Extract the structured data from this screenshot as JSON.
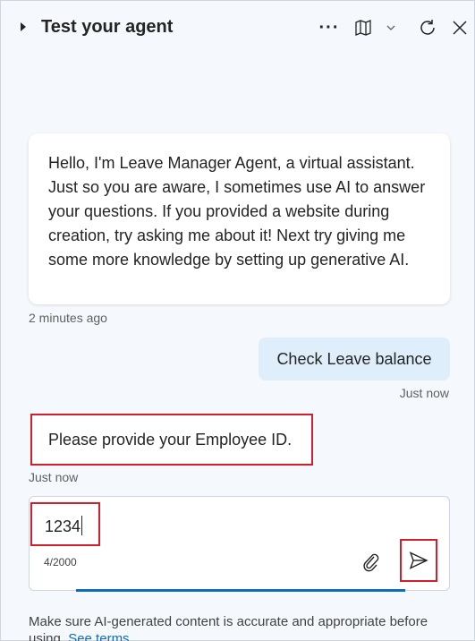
{
  "header": {
    "title": "Test your agent",
    "more_icon": "more-horizontal-icon",
    "map_icon": "map-icon",
    "chevron_icon": "chevron-down-icon",
    "refresh_icon": "refresh-icon",
    "close_icon": "close-icon"
  },
  "messages": [
    {
      "sender": "bot",
      "text": "Hello, I'm Leave Manager Agent, a virtual assistant. Just so you are aware, I sometimes use AI to answer your questions. If you provided a website during creation, try asking me about it! Next try giving me some more knowledge by setting up generative AI.",
      "timestamp": "2 minutes ago"
    },
    {
      "sender": "user",
      "text": "Check Leave balance",
      "timestamp": "Just now"
    },
    {
      "sender": "bot",
      "text": "Please provide your Employee ID.",
      "timestamp": "Just now"
    }
  ],
  "composer": {
    "value": "1234",
    "counter": "4/2000",
    "attach_icon": "paperclip-icon",
    "send_icon": "send-icon"
  },
  "disclaimer": {
    "text": "Make sure AI-generated content is accurate and appropriate before using.",
    "link": "See terms"
  },
  "colors": {
    "accent": "#0f6cbd",
    "highlight": "#d1202b",
    "user_bubble": "#deeefa"
  }
}
